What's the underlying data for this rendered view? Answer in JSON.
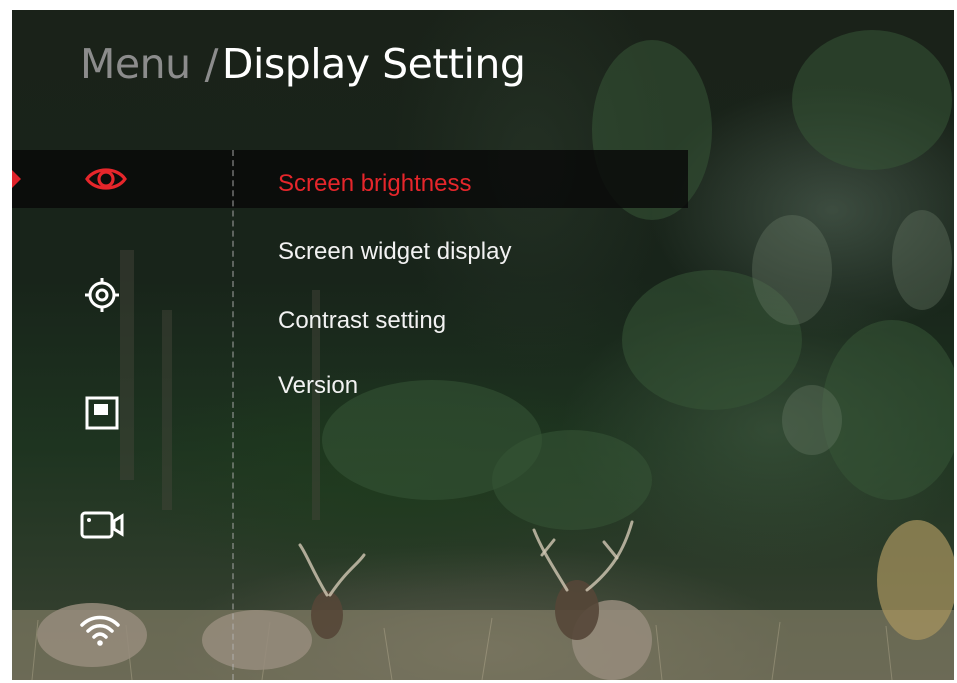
{
  "header": {
    "menu_label": "Menu",
    "separator": "/",
    "current_label": "Display Setting"
  },
  "sidebar": {
    "selected_index": 0,
    "items": [
      {
        "icon": "eye-icon",
        "color": "#e6262b",
        "active": true
      },
      {
        "icon": "crosshair-target-icon",
        "color": "#ffffff",
        "active": false
      },
      {
        "icon": "picture-in-picture-icon",
        "color": "#ffffff",
        "active": false
      },
      {
        "icon": "video-camera-icon",
        "color": "#ffffff",
        "active": false
      },
      {
        "icon": "wifi-icon",
        "color": "#ffffff",
        "active": false
      }
    ]
  },
  "submenu": {
    "selected_index": 0,
    "items": [
      {
        "label": "Screen brightness"
      },
      {
        "label": "Screen widget display"
      },
      {
        "label": "Contrast setting"
      },
      {
        "label": "Version"
      }
    ]
  },
  "colors": {
    "accent": "#e6262b",
    "text_primary": "#f2f2f2",
    "text_dim": "#8c8c8c",
    "highlight_bar": "#080808"
  }
}
